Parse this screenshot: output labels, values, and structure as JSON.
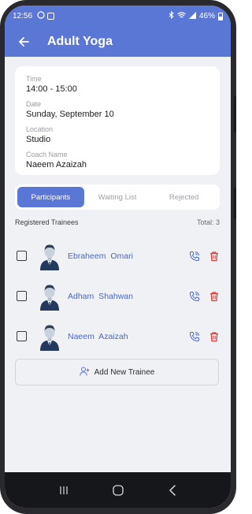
{
  "status_bar": {
    "time": "12:56",
    "battery": "46%"
  },
  "app_bar": {
    "title": "Adult Yoga"
  },
  "session": {
    "time_label": "Time",
    "time_value": "14:00 - 15:00",
    "date_label": "Date",
    "date_value": "Sunday, September 10",
    "location_label": "Location",
    "location_value": "Studio",
    "coach_label": "Coach Name",
    "coach_value": "Naeem Azaizah"
  },
  "tabs": [
    {
      "label": "Participants",
      "active": true
    },
    {
      "label": "Waiting List",
      "active": false
    },
    {
      "label": "Rejected",
      "active": false
    }
  ],
  "section": {
    "title": "Registered Trainees",
    "total": "Total: 3"
  },
  "trainees": [
    {
      "name": "Ebraheem  Omari"
    },
    {
      "name": "Adham  Shahwan"
    },
    {
      "name": "Naeem  Azaizah"
    }
  ],
  "add_button": {
    "label": "Add New Trainee"
  },
  "colors": {
    "primary": "#5b77d6",
    "name_link": "#4a66c2",
    "delete": "#e53935",
    "background": "#f0f1f5"
  },
  "icons": [
    "back-arrow-icon",
    "phone-icon",
    "trash-icon",
    "add-user-icon",
    "recent-apps-icon",
    "home-icon",
    "back-nav-icon"
  ]
}
